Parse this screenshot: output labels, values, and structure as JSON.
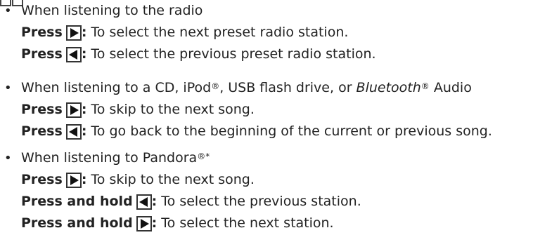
{
  "sections": [
    {
      "heading": "When listening to the radio",
      "items": [
        {
          "press": "Press",
          "direction": "next",
          "text": "To select the next preset radio station."
        },
        {
          "press": "Press",
          "direction": "previous",
          "text": "To select the previous preset radio station."
        }
      ]
    },
    {
      "heading_parts": {
        "a": "When listening to a CD, iPod",
        "b": ", USB flash drive, or ",
        "c": "Bluetooth",
        "d": " Audio"
      },
      "items": [
        {
          "press": "Press",
          "direction": "next",
          "text": "To skip to the next song."
        },
        {
          "press": "Press",
          "direction": "previous",
          "text": "To go back to the beginning of the current or previous song."
        }
      ]
    },
    {
      "heading_parts": {
        "a": "When listening to Pandora"
      },
      "items": [
        {
          "press": "Press",
          "direction": "next",
          "text": "To skip to the next song."
        },
        {
          "press": "Press and hold",
          "direction": "previous",
          "text": "To select the previous station."
        },
        {
          "press": "Press and hold",
          "direction": "next",
          "text": "To select the next station."
        }
      ]
    }
  ],
  "symbols": {
    "bullet": "•",
    "registered": "®",
    "asterisk": "*",
    "colon": ":"
  }
}
